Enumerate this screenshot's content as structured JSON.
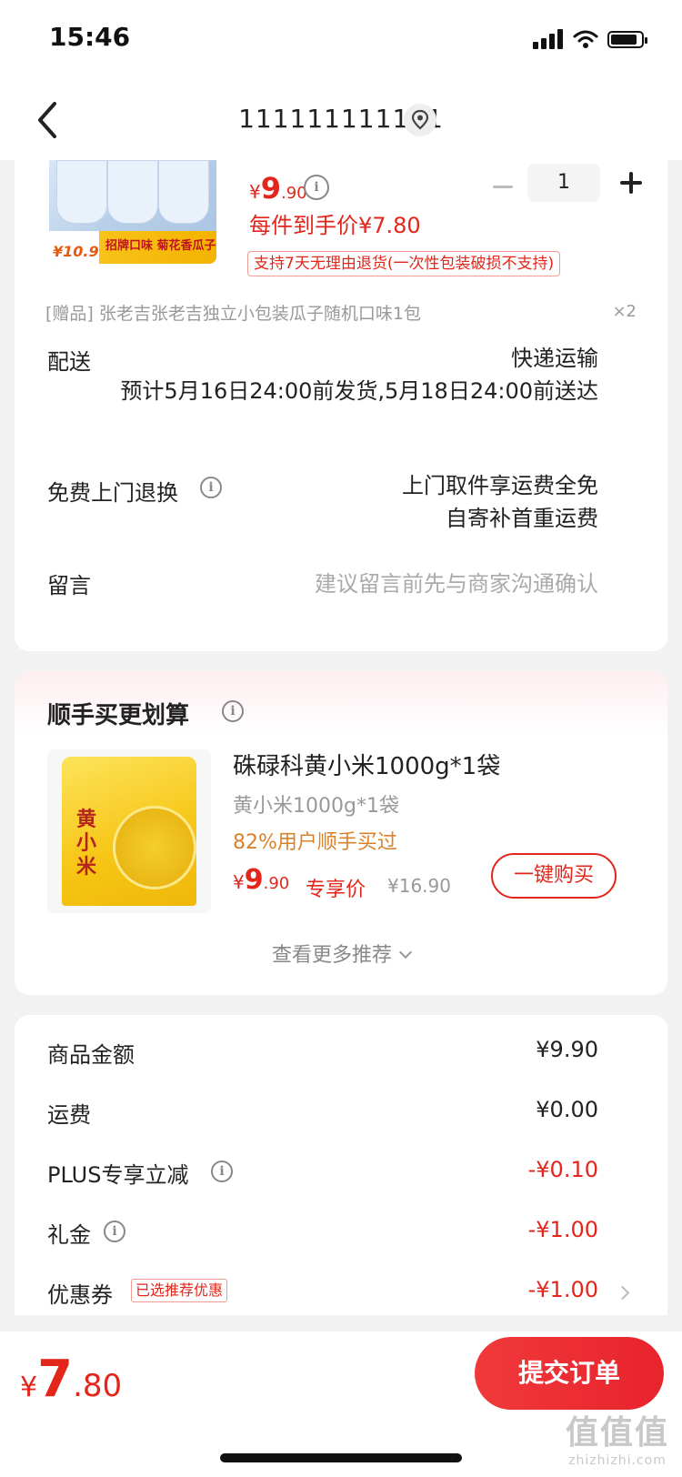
{
  "status_bar": {
    "time": "15:46"
  },
  "nav": {
    "title": "111111111111"
  },
  "product": {
    "thumb_price": "¥10.9",
    "thumb_slogan": "招牌口味 菊花香瓜子",
    "price_yen": "¥",
    "price_int": "9",
    "price_dec": ".90",
    "quantity": "1",
    "unit_price_text": "每件到手价¥7.80",
    "return_policy": "支持7天无理由退货(一次性包装破损不支持)",
    "gift_text": "[赠品] 张老吉张老吉独立小包装瓜子随机口味1包",
    "gift_count": "×2"
  },
  "delivery": {
    "label": "配送",
    "method": "快递运输",
    "estimate": "预计5月16日24:00前发货,5月18日24:00前送达"
  },
  "return_service": {
    "label": "免费上门退换",
    "line1": "上门取件享运费全免",
    "line2": "自寄补首重运费"
  },
  "message": {
    "label": "留言",
    "placeholder": "建议留言前先与商家沟通确认"
  },
  "recommend": {
    "title": "顺手买更划算",
    "thumb_label": "黄小米",
    "item_name": "硃碌科黄小米1000g*1袋",
    "item_spec": "黄小米1000g*1袋",
    "bought_text": "82%用户顺手买过",
    "price_yen": "¥",
    "price_int": "9",
    "price_dec": ".90",
    "price_tag": "专享价",
    "original_price": "¥16.90",
    "buy_button": "一键购买",
    "more_link": "查看更多推荐"
  },
  "summary": {
    "rows": [
      {
        "label": "商品金额",
        "value": "¥9.90"
      },
      {
        "label": "运费",
        "value": "¥0.00"
      },
      {
        "label": "PLUS专享立减",
        "value": "-¥0.10"
      },
      {
        "label": "礼金",
        "value": "-¥1.00"
      },
      {
        "label": "优惠券",
        "value": "-¥1.00",
        "badge": "已选推荐优惠"
      }
    ]
  },
  "bottom": {
    "total_yen": "¥",
    "total_int": "7",
    "total_dec": ".80",
    "submit_label": "提交订单"
  },
  "watermark": {
    "big": "值值值",
    "small": "zhizhizhi.com"
  },
  "colors": {
    "accent_red": "#e3261b",
    "bought_orange": "#d9822b"
  }
}
